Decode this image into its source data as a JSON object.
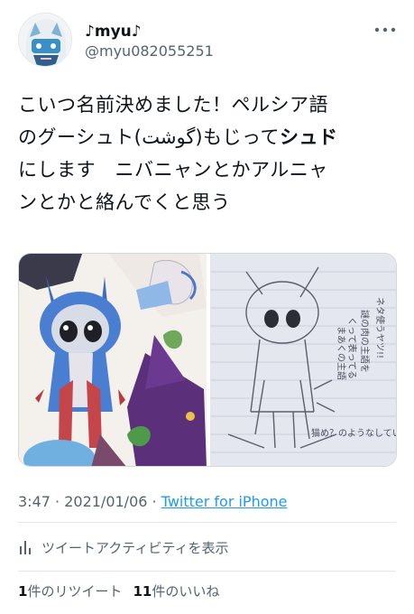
{
  "author": {
    "display_name": "♪myu♪",
    "handle": "@myu082055251"
  },
  "tweet": {
    "line1": "こいつ名前決めました！ペルシア語",
    "line2_pre": "のグーシュト(گوشت)もじって",
    "line2_bold": "シュド",
    "line3": "にします　ニバニャンとかアルニャ",
    "line4": "ンとかと絡んでくと思う"
  },
  "meta": {
    "time": "3:47",
    "sep1": " · ",
    "date": "2021/01/06",
    "sep2": " · ",
    "source": "Twitter for iPhone"
  },
  "activity_label": "ツイートアクティビティを表示",
  "stats": {
    "retweets_count": "1",
    "retweets_label": "件のリツイート",
    "likes_count": "11",
    "likes_label": "件のいいね"
  },
  "sketch_notes": [
    "ネタ使うヤツ!!",
    "謎の肉の主語を",
    "くって表ってる",
    "まあくの主語",
    "猫め？のようなしてい"
  ],
  "icons": [
    "avatar",
    "more-icon",
    "activity-icon"
  ],
  "colors": {
    "link": "#1d9bf0",
    "secondary": "#536471",
    "divider": "#e1e6ea"
  }
}
